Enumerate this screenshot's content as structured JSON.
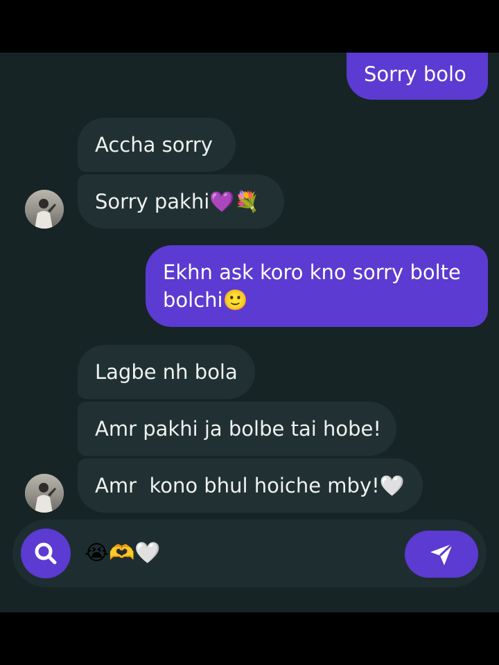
{
  "messages": [
    {
      "text": "Sorry bolo",
      "direction": "outgoing"
    },
    {
      "text": "Accha sorry",
      "direction": "incoming"
    },
    {
      "text": "Sorry pakhi💜💐",
      "direction": "incoming"
    },
    {
      "text": "Ekhn ask koro kno sorry bolte",
      "text2": "bolchi🙂",
      "direction": "outgoing"
    },
    {
      "text": "Lagbe nh bola",
      "direction": "incoming"
    },
    {
      "text": "Amr pakhi ja bolbe tai hobe!",
      "direction": "incoming"
    },
    {
      "text": "Amr  kono bhul hoiche mby!🤍",
      "direction": "incoming"
    }
  ],
  "composer": {
    "value": "😭🫶🤍"
  },
  "colors": {
    "background": "#172425",
    "incoming_bubble": "#213133",
    "outgoing_bubble": "#5b3bd1",
    "accent": "#5b3bd1"
  },
  "icons": {
    "search": "search-icon",
    "send": "send-icon",
    "avatar": "contact-avatar"
  }
}
